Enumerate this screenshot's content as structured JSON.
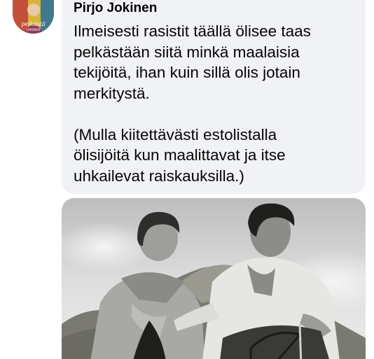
{
  "comment": {
    "author": "Pirjo Jokinen",
    "paragraphs": [
      "Ilmeisesti rasistit täällä ölisee taas\npelkästään siitä minkä maalaisia\ntekijöitä, ihan kuin sillä olis jotain\nmerkitystä.",
      "(Mulla kiitettävästi estolistalla\nölisijöitä kun maalittavat ja itse\nuhkailevat raiskauksilla.)"
    ],
    "avatar_icon": "profile-picture",
    "avatar_text": "pelkästä... JOKINEN",
    "attachment": "black-and-white-film-still-man-and-woman-on-hay-wagon"
  },
  "colors": {
    "bubble_background": "#f0f2f5",
    "text": "#050505"
  }
}
